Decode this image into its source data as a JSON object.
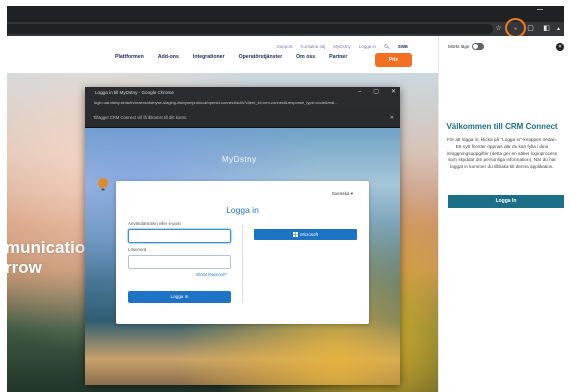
{
  "browser": {
    "minimize_glyph": "–",
    "toolbar_icons": [
      {
        "name": "star-icon",
        "glyph": "☆"
      },
      {
        "name": "extension-icon",
        "glyph": "●"
      },
      {
        "name": "bookmark-icon",
        "glyph": "▢"
      },
      {
        "name": "sidepanel-icon",
        "glyph": "◧"
      },
      {
        "name": "profile-icon",
        "glyph": "▲"
      }
    ],
    "highlight_color": "#f07a21"
  },
  "site": {
    "util_nav": [
      "Support",
      "Kontakta säj",
      "MyDstny",
      "Logga in"
    ],
    "lang": "SWE",
    "main_nav": [
      "Plattformen",
      "Add-ons",
      "Integrationer",
      "Operatörstjänster",
      "Om oss",
      "Partner"
    ],
    "cta": "Pris",
    "hero_text": "munication\nrrow",
    "accent": "#f36f21"
  },
  "popup": {
    "window_title": "Logga in till MyDstny - Google Chrome",
    "url": "login.uat.dstny.se/auth/realms/dstnyse-staging-dstnyse/protocol/openid-connect/auth?client_id=crm-connect&response_type=code&redi...",
    "info_bar": "Tillägget CRM Connect vill få åtkomst till ditt konto.",
    "brand": "MyDstny",
    "language": "Svenska ▾",
    "login_title": "Logga in",
    "username_label": "Användarnamn eller e-post",
    "password_label": "Lösenord",
    "forgot_link": "Glömt lösenord?",
    "login_button": "Logga In",
    "microsoft_button": "Microsoft"
  },
  "panel": {
    "dark_mode_label": "Mörkt läge",
    "title": "Välkommen till CRM Connect",
    "description": "För att logga in, klicka på \"Logga in\"-knappen nedan. Ett nytt fönster öppnas där du kan fylla i dina inloggningsuppgifter (detta ger en säker loginprocess som skyddar din personliga information). När du har loggat in kommer du tillbaka till denna applikation.",
    "login_button": "Logga In",
    "accent": "#1b6f86"
  }
}
